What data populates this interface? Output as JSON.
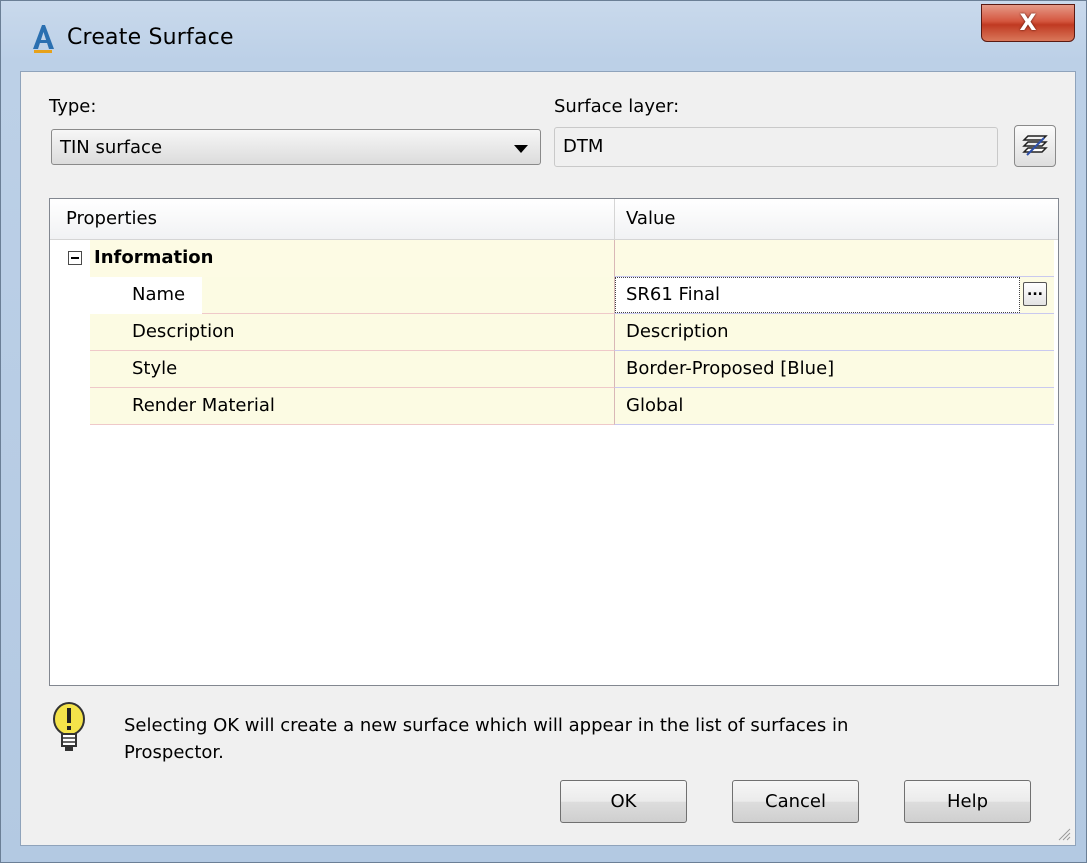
{
  "window": {
    "title": "Create Surface",
    "close_label": "X"
  },
  "type_field": {
    "label": "Type:",
    "value": "TIN surface"
  },
  "layer_field": {
    "label": "Surface layer:",
    "value": "DTM"
  },
  "grid": {
    "columns": [
      "Properties",
      "Value"
    ],
    "group": {
      "label": "Information",
      "expanded": true
    },
    "rows": [
      {
        "property": "Name",
        "value": "SR61 Final"
      },
      {
        "property": "Description",
        "value": "Description"
      },
      {
        "property": "Style",
        "value": "Border-Proposed [Blue]"
      },
      {
        "property": "Render Material",
        "value": "Global"
      }
    ],
    "ellipsis_label": "..."
  },
  "info": {
    "line1": "Selecting OK will create a new surface which will appear in the list of surfaces in",
    "line2": "Prospector."
  },
  "buttons": {
    "ok": "OK",
    "cancel": "Cancel",
    "help": "Help"
  },
  "icons": {
    "app": "autocad-civil-icon",
    "layer": "layers-icon",
    "info": "lightbulb-warning-icon"
  },
  "colors": {
    "close_button": "#c8452b",
    "grid_row_background": "#fcfbe3"
  }
}
